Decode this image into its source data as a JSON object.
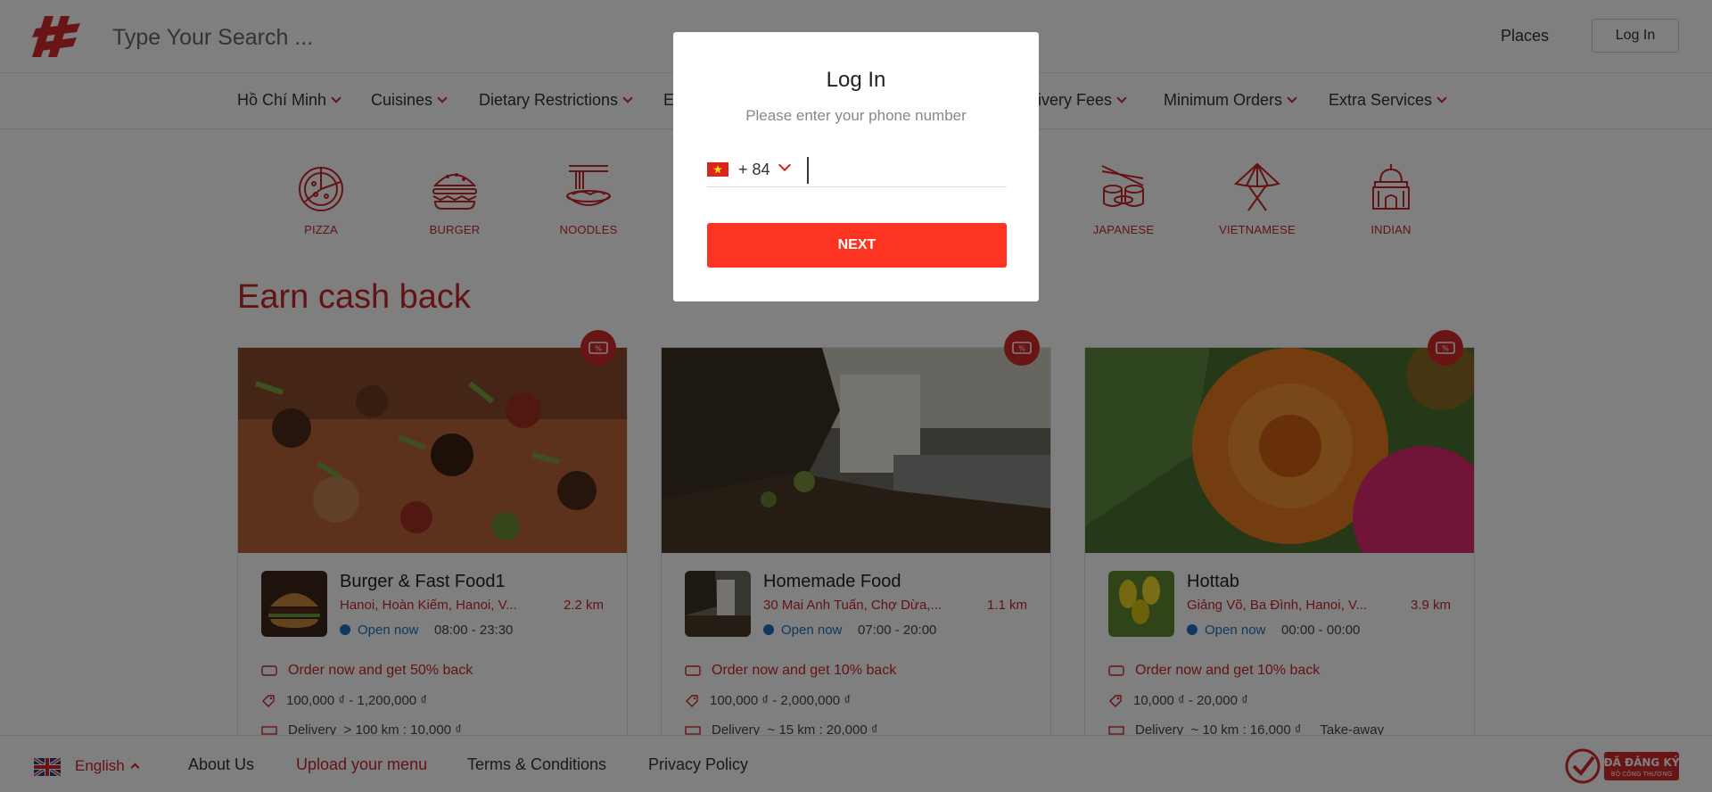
{
  "header": {
    "search_placeholder": "Type Your Search ...",
    "places": "Places",
    "login": "Log In"
  },
  "filters": [
    "Hồ Chí Minh",
    "Cuisines",
    "Dietary Restrictions",
    "E",
    "elivery Fees",
    "Minimum Orders",
    "Extra Services"
  ],
  "categories": [
    "PIZZA",
    "BURGER",
    "NOODLES",
    "JAPANESE",
    "VIETNAMESE",
    "INDIAN"
  ],
  "section_title": "Earn cash back",
  "cards": [
    {
      "name": "Burger & Fast Food1",
      "address": "Hanoi, Hoàn Kiếm, Hanoi, V...",
      "distance": "2.2 km",
      "status": "Open now",
      "hours": "08:00 - 23:30",
      "offer": "Order now and get 50% back",
      "price": "100,000 ₫ - 1,200,000 ₫",
      "delivery": "Delivery",
      "delivery_info": "> 100 km : 10,000 ₫"
    },
    {
      "name": "Homemade Food",
      "address": "30 Mai Anh Tuấn, Chợ Dừa,...",
      "distance": "1.1 km",
      "status": "Open now",
      "hours": "07:00 - 20:00",
      "offer": "Order now and get 10% back",
      "price": "100,000 ₫ - 2,000,000 ₫",
      "delivery": "Delivery",
      "delivery_info": "~ 15 km : 20,000 ₫"
    },
    {
      "name": "Hottab",
      "address": "Giảng Võ, Ba Đình, Hanoi, V...",
      "distance": "3.9 km",
      "status": "Open now",
      "hours": "00:00 - 00:00",
      "offer": "Order now and get 10% back",
      "price": "10,000 ₫ - 20,000 ₫",
      "delivery": "Delivery",
      "delivery_info": "~ 10 km : 16,000 ₫",
      "extra": "Take-away"
    }
  ],
  "footer": {
    "language": "English",
    "about": "About Us",
    "upload": "Upload your menu",
    "terms": "Terms & Conditions",
    "privacy": "Privacy Policy",
    "reg_line1": "ĐÃ ĐĂNG KÝ",
    "reg_line2": "BỘ CÔNG THƯƠNG"
  },
  "modal": {
    "title": "Log In",
    "subtitle": "Please enter your phone number",
    "country_code": "+ 84",
    "next": "NEXT"
  },
  "colors": {
    "brand_red": "#c8262b",
    "button_red": "#fd3422",
    "open_blue": "#1e6fbf"
  }
}
